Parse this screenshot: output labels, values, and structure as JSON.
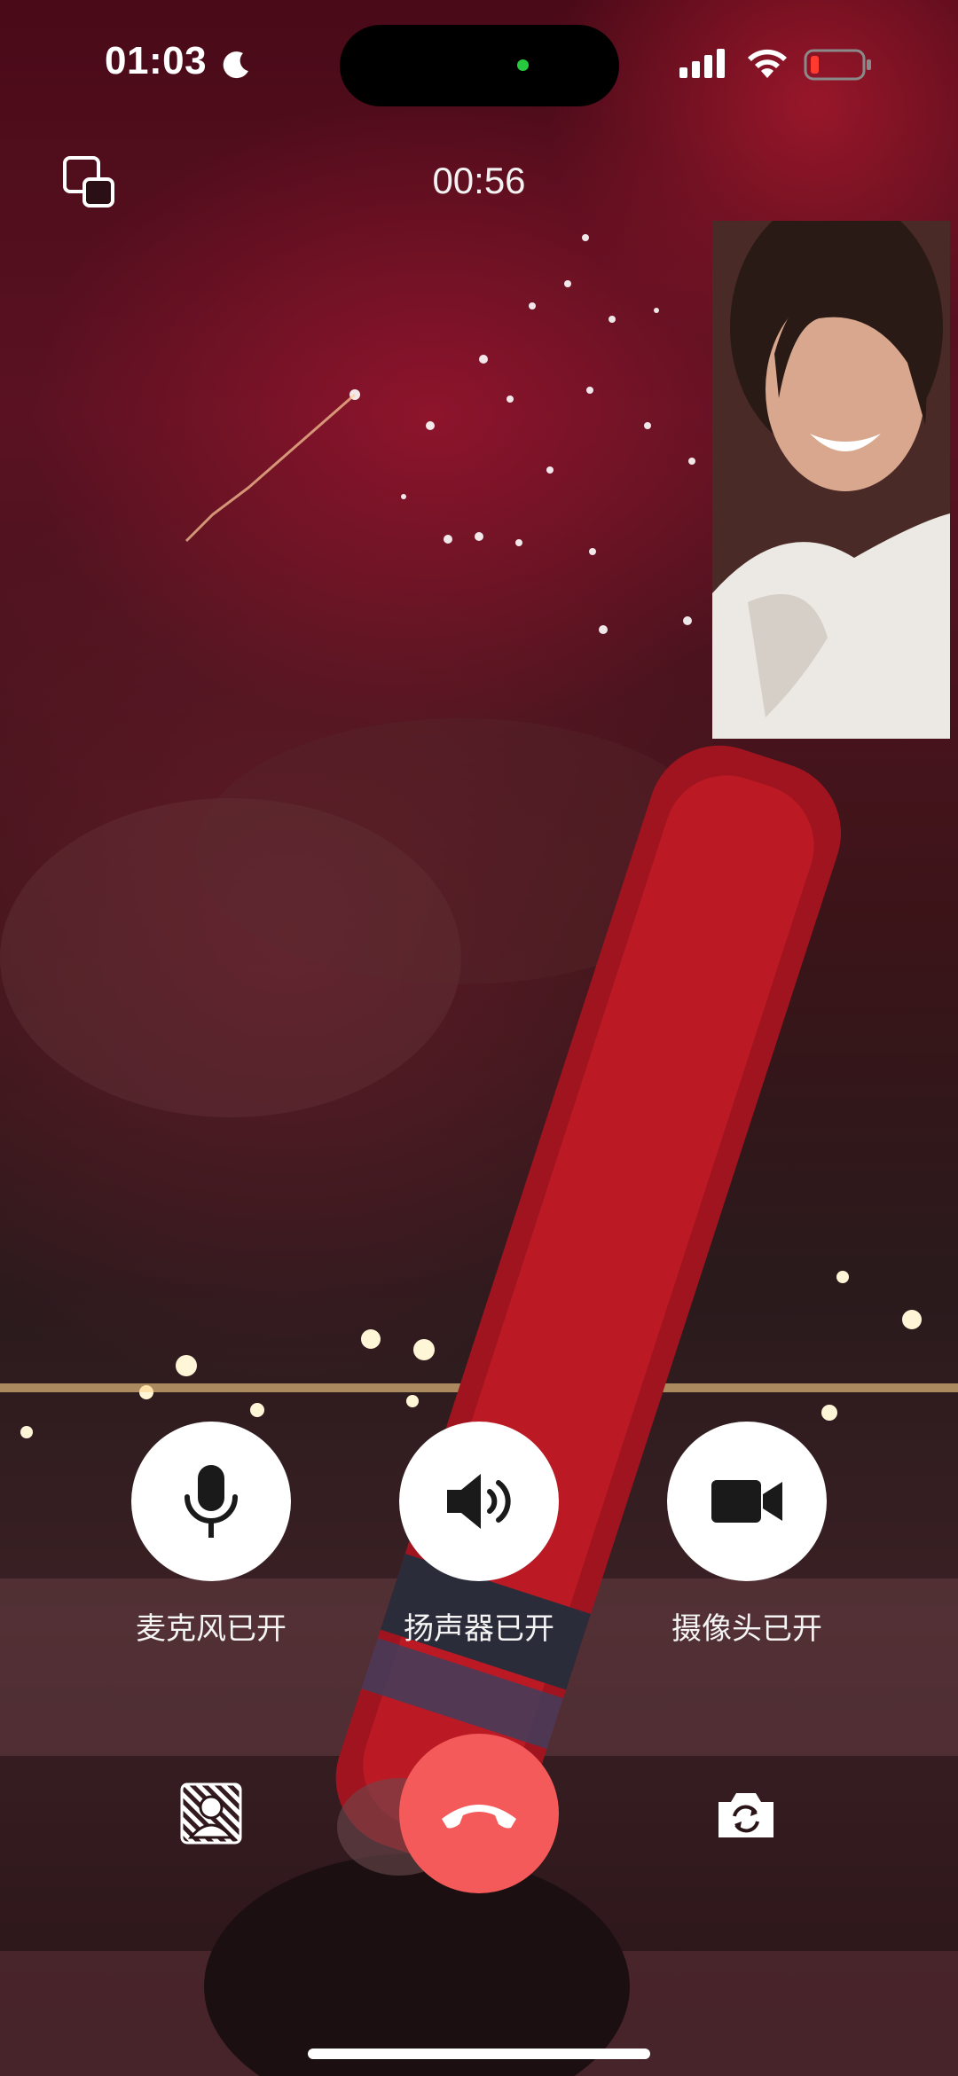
{
  "status_bar": {
    "time": "01:03",
    "moon_icon": "moon-icon",
    "signal_icon": "cellular-signal-icon",
    "wifi_icon": "wifi-icon",
    "battery_icon": "battery-low-icon",
    "battery_color": "#ff3b30"
  },
  "call": {
    "timer": "00:56",
    "switch_icon": "switch-window-icon"
  },
  "controls": [
    {
      "label": "麦克风已开",
      "icon": "microphone-icon"
    },
    {
      "label": "扬声器已开",
      "icon": "speaker-icon"
    },
    {
      "label": "摄像头已开",
      "icon": "video-camera-icon"
    }
  ],
  "bottom": {
    "blur_icon": "background-blur-icon",
    "hangup_icon": "hang-up-phone-icon",
    "hangup_color": "#f45a5a",
    "flip_icon": "flip-camera-icon"
  }
}
